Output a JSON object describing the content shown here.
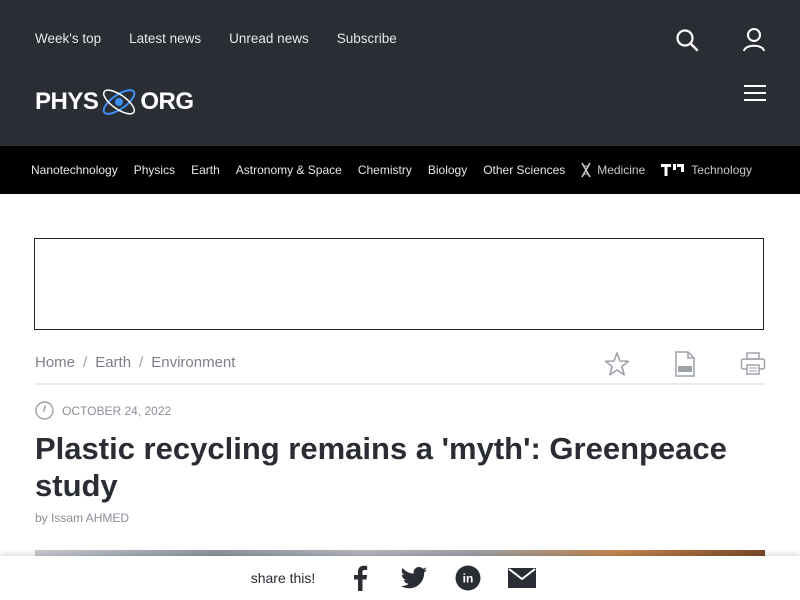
{
  "topnav": {
    "items": [
      "Week's top",
      "Latest news",
      "Unread news",
      "Subscribe"
    ]
  },
  "logo": {
    "left": "PHYS",
    "right": "ORG"
  },
  "categories": [
    {
      "label": "Nanotechnology"
    },
    {
      "label": "Physics"
    },
    {
      "label": "Earth"
    },
    {
      "label": "Astronomy & Space"
    },
    {
      "label": "Chemistry"
    },
    {
      "label": "Biology"
    },
    {
      "label": "Other Sciences"
    },
    {
      "label": "Medicine",
      "icon": "dna-icon"
    },
    {
      "label": "Technology",
      "icon": "tx-logo-icon"
    }
  ],
  "breadcrumb": {
    "items": [
      "Home",
      "Earth",
      "Environment"
    ],
    "separator": "/"
  },
  "article": {
    "date": "OCTOBER 24, 2022",
    "title": "Plastic recycling remains a 'myth': Greenpeace study",
    "byline": "by Issam AHMED"
  },
  "share": {
    "label": "share this!"
  },
  "colors": {
    "header": "#2a2d34",
    "catnav": "#000000",
    "accent": "#3c8ff5"
  }
}
